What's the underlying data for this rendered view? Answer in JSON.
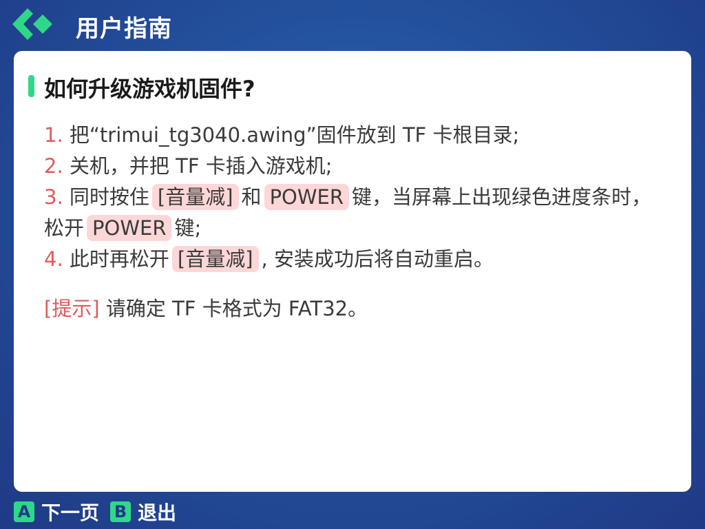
{
  "header": {
    "title": "用户指南",
    "logo_icon": "diamond-arrow-logo-icon",
    "accent_color": "#2fd889"
  },
  "content": {
    "question": "如何升级游戏机固件?",
    "steps": [
      {
        "num": "1.",
        "text": "把“trimui_tg3040.awing”固件放到 TF 卡根目录;"
      },
      {
        "num": "2.",
        "text": "关机，并把 TF 卡插入游戏机;"
      },
      {
        "num": "3.",
        "pre": "同时按住",
        "hl1": "[音量减]",
        "mid": "和",
        "hl2": "POWER",
        "post": "键，当屏幕上出现绿色进度条时，松开",
        "hl3": "POWER",
        "end": "键;"
      },
      {
        "num": "4.",
        "pre": "此时再松开",
        "hl1": "[音量减]",
        "post": ", 安装成功后将自动重启。"
      }
    ],
    "hint_tag": "[提示]",
    "hint_text": "请确定 TF 卡格式为 FAT32。"
  },
  "footer": {
    "btn_a": {
      "key": "A",
      "label": "下一页"
    },
    "btn_b": {
      "key": "B",
      "label": "退出"
    }
  },
  "colors": {
    "background": "#23509c",
    "step_number": "#e05a5a",
    "highlight_bg": "#fdd7d7"
  }
}
